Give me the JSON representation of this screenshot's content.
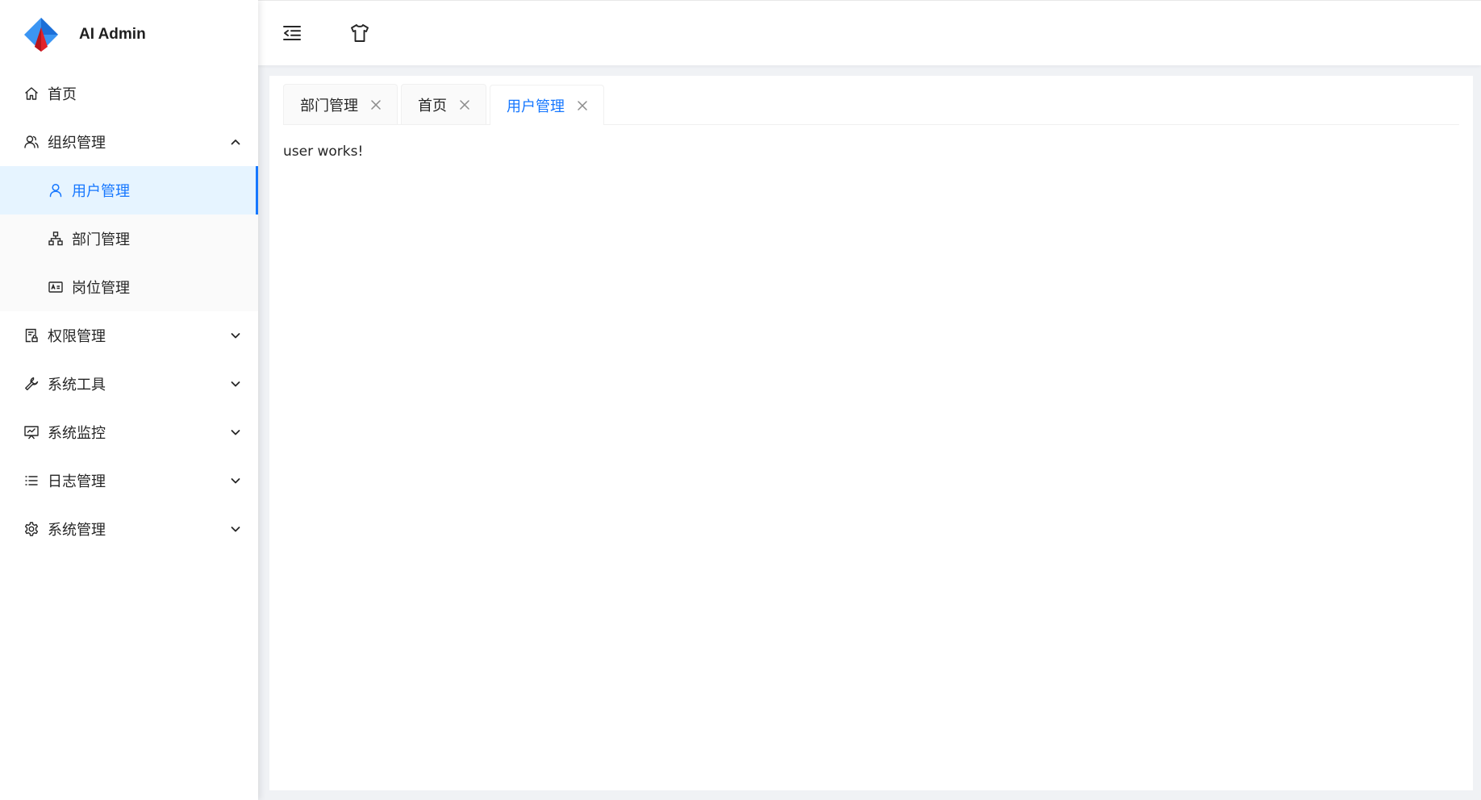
{
  "app": {
    "title": "AI Admin"
  },
  "sidebar": {
    "items": [
      {
        "label": "首页",
        "icon": "home-icon"
      },
      {
        "label": "组织管理",
        "icon": "team-icon",
        "expanded": true,
        "children": [
          {
            "label": "用户管理",
            "icon": "user-icon",
            "active": true
          },
          {
            "label": "部门管理",
            "icon": "org-chart-icon"
          },
          {
            "label": "岗位管理",
            "icon": "id-card-icon"
          }
        ]
      },
      {
        "label": "权限管理",
        "icon": "file-lock-icon"
      },
      {
        "label": "系统工具",
        "icon": "wrench-icon"
      },
      {
        "label": "系统监控",
        "icon": "monitor-icon"
      },
      {
        "label": "日志管理",
        "icon": "list-icon"
      },
      {
        "label": "系统管理",
        "icon": "setting-icon"
      }
    ]
  },
  "header": {
    "buttons": [
      {
        "icon": "menu-fold-icon"
      },
      {
        "icon": "skin-icon"
      }
    ]
  },
  "tabs": [
    {
      "label": "部门管理",
      "active": false
    },
    {
      "label": "首页",
      "active": false
    },
    {
      "label": "用户管理",
      "active": true
    }
  ],
  "main": {
    "text": "user works!"
  },
  "colors": {
    "accent": "#1677ff",
    "active_bg": "#e6f4ff",
    "submenu_bg": "#fafafa",
    "page_bg": "#f0f2f5"
  }
}
